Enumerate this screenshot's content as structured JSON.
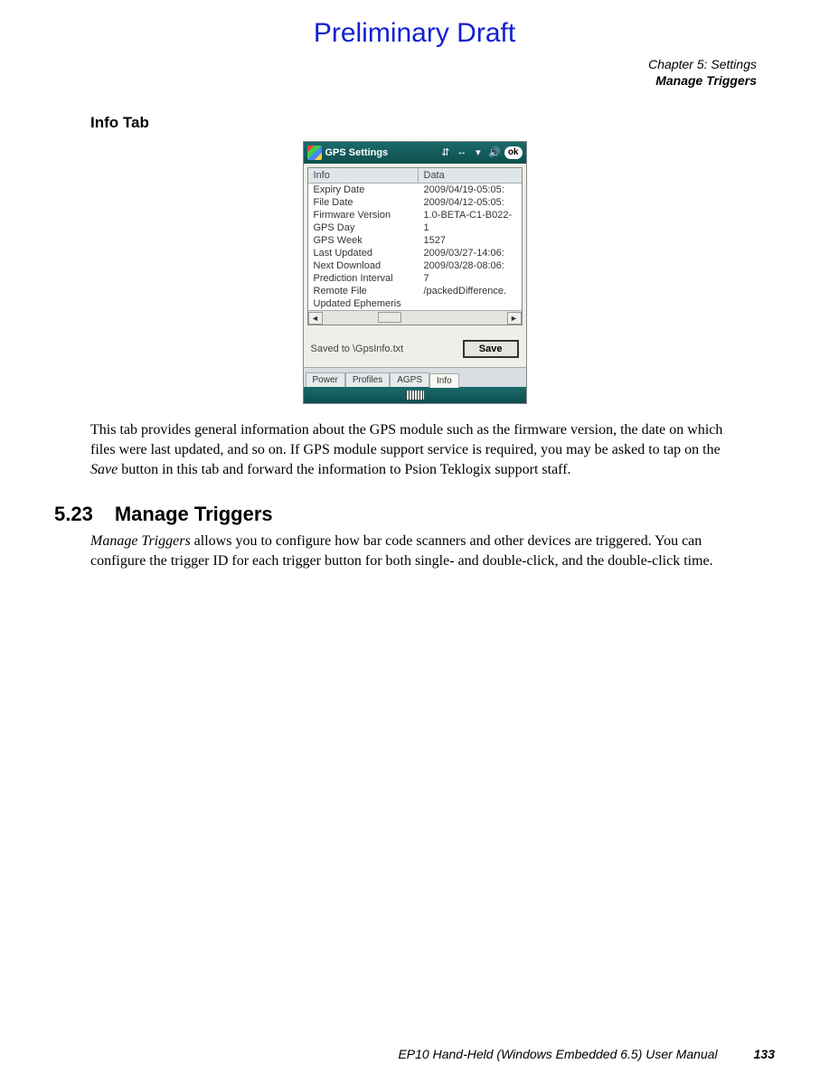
{
  "draft": "Preliminary Draft",
  "chapter": {
    "line1": "Chapter 5: Settings",
    "line2": "Manage Triggers"
  },
  "info_tab_title": "Info Tab",
  "screenshot": {
    "title": "GPS Settings",
    "ok": "ok",
    "headers": {
      "info": "Info",
      "data": "Data"
    },
    "rows": [
      {
        "info": "Expiry Date",
        "data": "2009/04/19-05:05:"
      },
      {
        "info": "File Date",
        "data": "2009/04/12-05:05:"
      },
      {
        "info": "Firmware Version",
        "data": "1.0-BETA-C1-B022-"
      },
      {
        "info": "GPS Day",
        "data": "1"
      },
      {
        "info": "GPS Week",
        "data": "1527"
      },
      {
        "info": "Last Updated",
        "data": "2009/03/27-14:06:"
      },
      {
        "info": "Next Download",
        "data": "2009/03/28-08:06:"
      },
      {
        "info": "Prediction Interval",
        "data": "7"
      },
      {
        "info": "Remote File",
        "data": "/packedDifference."
      },
      {
        "info": "Updated Ephemeris",
        "data": ""
      }
    ],
    "saved_to": "Saved to \\GpsInfo.txt",
    "save_label": "Save",
    "tabs": [
      "Power",
      "Profiles",
      "AGPS",
      "Info"
    ],
    "active_tab": "Info"
  },
  "para1_a": "This tab provides general information about the GPS module such as the firmware version, the date on which files were last updated, and so on. If GPS module support service is re­quired, you may be asked to tap on the ",
  "para1_save": "Save",
  "para1_b": " button in this tab and forward the information to Psion Teklogix support staff.",
  "section": {
    "num": "5.23",
    "title": "Manage Triggers"
  },
  "para2_a": "Manage Triggers",
  "para2_b": " allows you to configure how bar code scanners and other devices are trig­gered. You can configure the trigger ID for each trigger button for both single- and double-click, and the double-click time.",
  "footer": {
    "manual": "EP10 Hand-Held (Windows Embedded 6.5) User Manual",
    "page": "133"
  }
}
